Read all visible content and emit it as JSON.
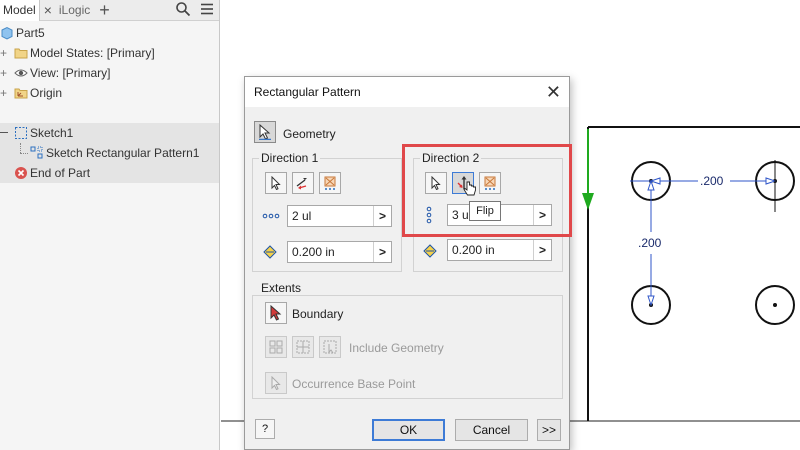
{
  "browser": {
    "tabs": [
      {
        "label": "Model",
        "active": true
      },
      {
        "label": "iLogic",
        "active": false
      }
    ],
    "tab_close": "×",
    "tab_add": "+",
    "tree": [
      {
        "label": "Part5",
        "icon": "part-cube-icon"
      },
      {
        "label": "Model States: [Primary]",
        "icon": "folder-icon"
      },
      {
        "label": "View: [Primary]",
        "icon": "eye-icon"
      },
      {
        "label": "Origin",
        "icon": "origin-folder-icon"
      },
      {
        "label": "Sketch1",
        "icon": "sketch-icon"
      },
      {
        "label": "Sketch Rectangular Pattern1",
        "icon": "sketch-pattern-icon"
      },
      {
        "label": "End of Part",
        "icon": "end-of-part-icon"
      }
    ]
  },
  "dialog": {
    "title": "Rectangular Pattern",
    "geometry_label": "Geometry",
    "direction1": {
      "label": "Direction 1",
      "count": "2 ul",
      "spacing": "0.200 in"
    },
    "direction2": {
      "label": "Direction 2",
      "count": "3 ul",
      "spacing": "0.200 in"
    },
    "extents": {
      "label": "Extents",
      "boundary_label": "Boundary",
      "include_geometry_label": "Include Geometry",
      "occurrence_label": "Occurrence Base Point"
    },
    "ok_label": "OK",
    "cancel_label": "Cancel",
    "more_label": ">>",
    "help_label": "?",
    "tooltip": "Flip",
    "field_arrow": ">"
  },
  "canvas": {
    "dim_horizontal": ".200",
    "dim_vertical": ".200"
  },
  "colors": {
    "highlight": "#e0484a",
    "axis_green": "#1faa1f",
    "dimension_blue": "#2f56c9"
  }
}
